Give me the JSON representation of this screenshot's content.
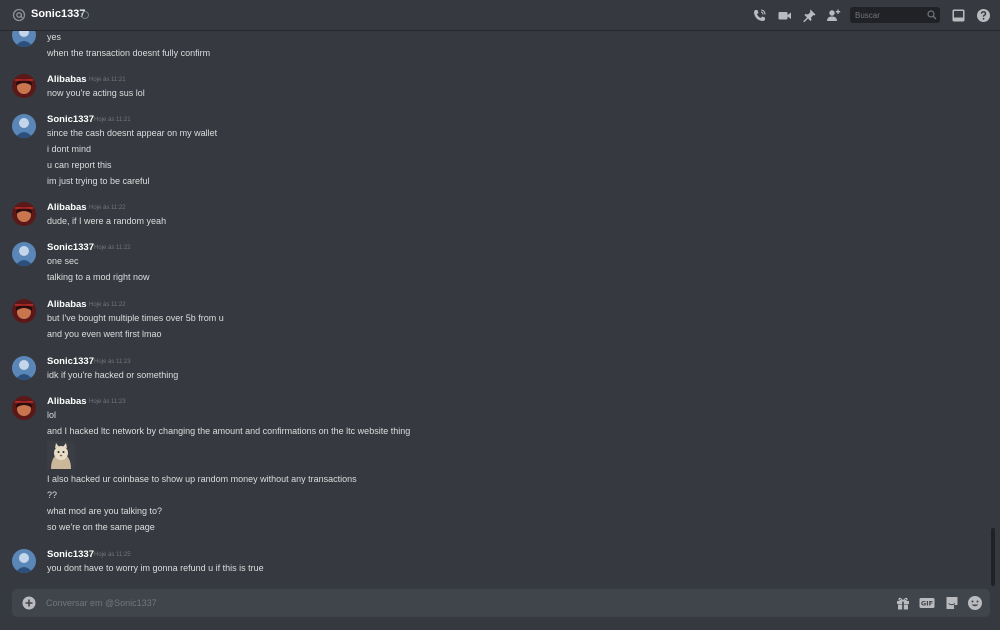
{
  "header": {
    "channel_name": "Sonic1337",
    "search_placeholder": "Buscar",
    "icons": [
      "at-icon",
      "status-icon",
      "phone-call-icon",
      "video-call-icon",
      "pin-icon",
      "add-friend-icon",
      "search-icon",
      "inbox-icon",
      "help-icon"
    ]
  },
  "colors": {
    "background": "#36393f",
    "header_border": "#26282c",
    "search_bg": "#202225",
    "composer_bg": "#40444b",
    "username": "#ffffff",
    "message_text": "#dcddde",
    "timestamp": "#72767d"
  },
  "messages": {
    "g0": {
      "lines": [
        "yes",
        "when the transaction doesnt fully confirm"
      ]
    },
    "g1": {
      "author": "Alibabas",
      "time": "Hoje às 11:21",
      "lines": [
        "now you're acting sus lol"
      ]
    },
    "g2": {
      "author": "Sonic1337",
      "time": "Hoje às 11:21",
      "lines": [
        "since the cash doesnt appear on my wallet",
        "i dont mind",
        "u can report this",
        "im just trying to be careful"
      ]
    },
    "g3": {
      "author": "Alibabas",
      "time": "Hoje às 11:22",
      "lines": [
        "dude, if I were a random yeah"
      ]
    },
    "g4": {
      "author": "Sonic1337",
      "time": "Hoje às 11:22",
      "lines": [
        "one sec",
        "talking to a mod right now"
      ]
    },
    "g5": {
      "author": "Alibabas",
      "time": "Hoje às 11:22",
      "lines": [
        "but I've bought multiple times over 5b from u",
        "and you even went first lmao"
      ]
    },
    "g6": {
      "author": "Sonic1337",
      "time": "Hoje às 11:23",
      "lines": [
        "idk if you're hacked or something"
      ]
    },
    "g7": {
      "author": "Alibabas",
      "time": "Hoje às 11:23",
      "lines": [
        "lol",
        "and I hacked ltc network by changing the amount and confirmations on the ltc website thing",
        "I also hacked ur coinbase to show up random money without any transactions",
        "??",
        "what mod are you talking to?",
        "so we're on the same page"
      ]
    },
    "g8": {
      "author": "Sonic1337",
      "time": "Hoje às 11:25",
      "lines": [
        "you dont have to worry im gonna refund u if this is true"
      ]
    }
  },
  "composer": {
    "placeholder": "Conversar em @Sonic1337",
    "icons": [
      "add-icon",
      "gift-icon",
      "gif-icon",
      "sticker-icon",
      "emoji-icon"
    ]
  }
}
